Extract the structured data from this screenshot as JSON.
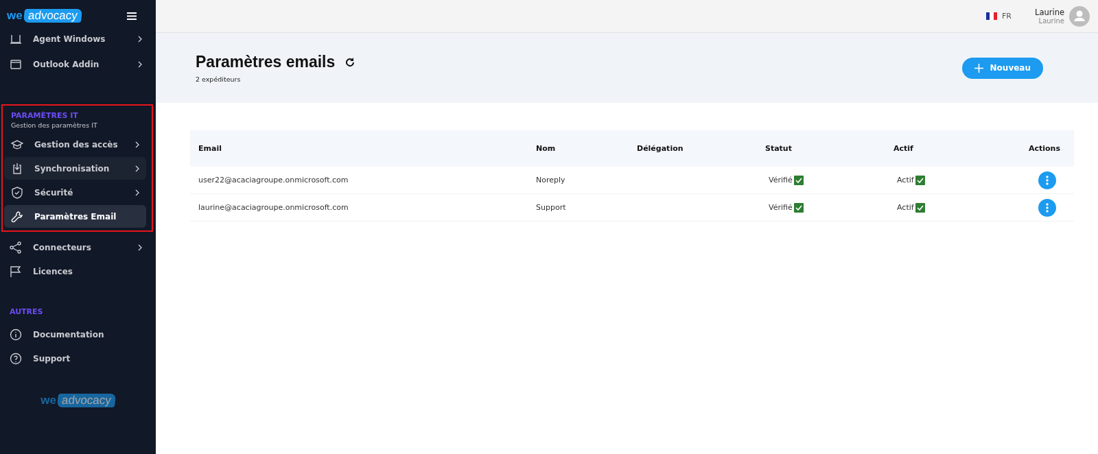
{
  "sidebar": {
    "logo": {
      "prefix": "we",
      "word": "advocacy"
    },
    "top_items": [
      {
        "label": "Agent Windows",
        "kind": "laptop",
        "submenu": true,
        "selected": false,
        "hovered": false
      },
      {
        "label": "Outlook Addin",
        "kind": "window",
        "submenu": true,
        "selected": false,
        "hovered": false
      }
    ],
    "sections": [
      {
        "title": "PARAMÈTRES IT",
        "subtitle": "Gestion des paramètres IT",
        "highlighted": true,
        "items": [
          {
            "label": "Gestion des accès",
            "kind": "cap",
            "submenu": true,
            "selected": false,
            "hovered": false
          },
          {
            "label": "Synchronisation",
            "kind": "download",
            "submenu": true,
            "selected": false,
            "hovered": true
          },
          {
            "label": "Sécurité",
            "kind": "shield",
            "submenu": true,
            "selected": false,
            "hovered": false
          },
          {
            "label": "Paramètres Email",
            "kind": "wrench",
            "submenu": false,
            "selected": true,
            "hovered": false
          }
        ]
      },
      {
        "highlighted": false,
        "items": [
          {
            "label": "Connecteurs",
            "kind": "share",
            "submenu": true,
            "selected": false,
            "hovered": false
          },
          {
            "label": "Licences",
            "kind": "flag",
            "submenu": false,
            "selected": false,
            "hovered": false
          }
        ]
      },
      {
        "title": "AUTRES",
        "highlighted": false,
        "items": [
          {
            "label": "Documentation",
            "kind": "info",
            "submenu": false,
            "selected": false,
            "hovered": false
          },
          {
            "label": "Support",
            "kind": "help",
            "submenu": false,
            "selected": false,
            "hovered": false
          }
        ]
      }
    ],
    "footer_logo": {
      "prefix": "we",
      "word": "advocacy"
    }
  },
  "topbar": {
    "language": "FR",
    "user": {
      "name": "Laurine",
      "subtitle": "Laurine"
    }
  },
  "header": {
    "title": "Paramètres emails",
    "subtitle": "2 expéditeurs",
    "new_button": "Nouveau"
  },
  "table": {
    "columns": [
      "Email",
      "Nom",
      "Délégation",
      "Statut",
      "Actif",
      "Actions"
    ],
    "rows": [
      {
        "email": "user22@acaciagroupe.onmicrosoft.com",
        "name": "Noreply",
        "status": "Vérifié",
        "status_ok": true,
        "active": "Actif",
        "active_ok": true
      },
      {
        "email": "laurine@acaciagroupe.onmicrosoft.com",
        "name": "Support",
        "status": "Vérifié",
        "status_ok": true,
        "active": "Actif",
        "active_ok": true
      }
    ]
  }
}
